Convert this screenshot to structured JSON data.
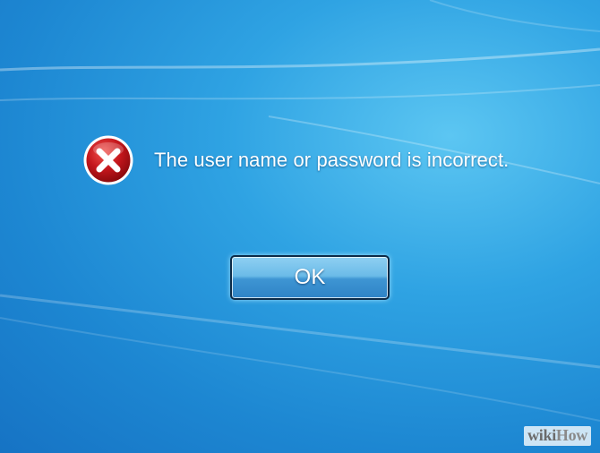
{
  "logon_error": {
    "message": "The user name or password is incorrect.",
    "icon": "error-x-icon",
    "ok_label": "OK"
  },
  "watermark": {
    "part1": "wiki",
    "part2": "How"
  },
  "colors": {
    "background": "#2fa3e3",
    "icon_red": "#c4161c",
    "button_border": "#0d2b48",
    "text": "#ffffff"
  }
}
